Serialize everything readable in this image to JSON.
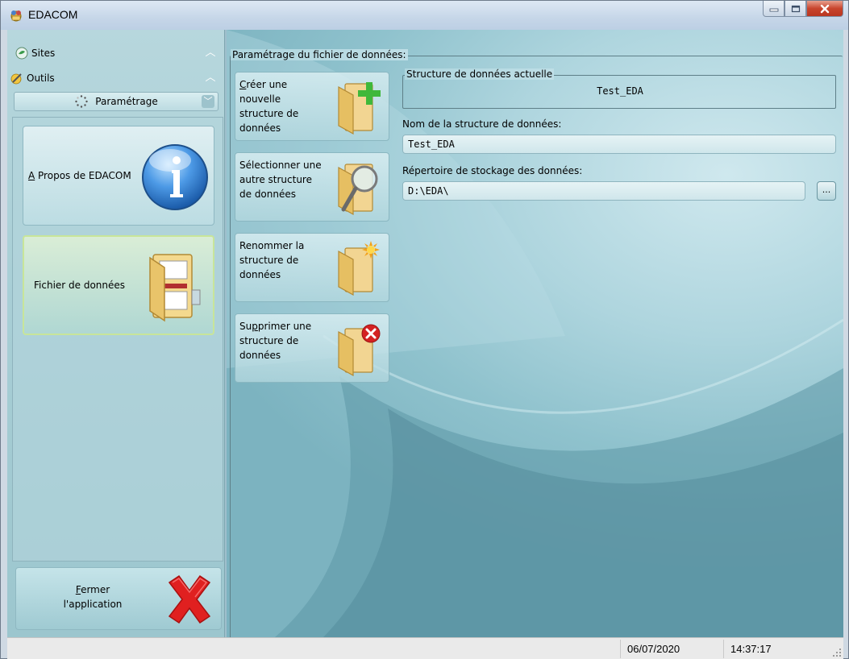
{
  "window": {
    "title": "EDACOM"
  },
  "nav": {
    "sites_label": "Sites",
    "outils_label": "Outils",
    "parametrage_label": "Paramétrage",
    "tiles": [
      {
        "label_prefix": "A",
        "label_rest": " Propos de EDACOM"
      },
      {
        "label": "Fichier de données"
      }
    ],
    "close": {
      "line1_prefix": "F",
      "line1_rest": "ermer",
      "line2": "l'application"
    }
  },
  "main": {
    "group_title": "Paramétrage du fichier de données:",
    "actions": [
      {
        "l1_prefix": "C",
        "l1_rest": "réer une",
        "l2": "nouvelle",
        "l3": "structure de",
        "l4": "données"
      },
      {
        "l1": "Sélectionner une",
        "l2": "autre structure",
        "l3": "de données"
      },
      {
        "l1": "Renommer la",
        "l2": "structure de",
        "l3": "données"
      },
      {
        "l1_prefix": "Su",
        "l1_u": "p",
        "l1_rest": "primer une",
        "l2": "structure de",
        "l3": "données"
      }
    ],
    "current_group_title": "Structure de données actuelle",
    "current_value": "Test_EDA",
    "name_label": "Nom de la structure de données:",
    "name_value": "Test_EDA",
    "dir_label": "Répertoire de stockage des données:",
    "dir_value": "D:\\EDA\\",
    "browse_label": "..."
  },
  "status": {
    "date": "06/07/2020",
    "time": "14:37:17"
  }
}
